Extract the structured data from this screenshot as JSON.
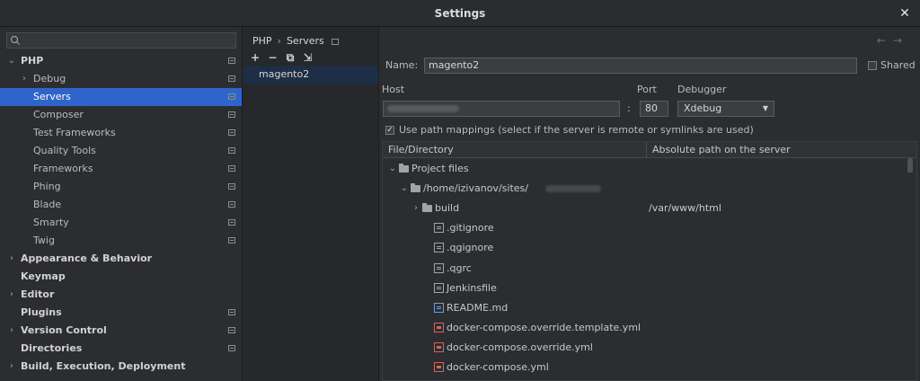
{
  "window": {
    "title": "Settings",
    "close_label": "✕"
  },
  "search": {
    "placeholder": ""
  },
  "tree": [
    {
      "label": "PHP",
      "level": 0,
      "arrow": "⌄",
      "bold": true,
      "project": true
    },
    {
      "label": "Debug",
      "level": 1,
      "arrow": "›",
      "project": true
    },
    {
      "label": "Servers",
      "level": 1,
      "selected": true,
      "project": true
    },
    {
      "label": "Composer",
      "level": 1,
      "project": true
    },
    {
      "label": "Test Frameworks",
      "level": 1,
      "project": true
    },
    {
      "label": "Quality Tools",
      "level": 1,
      "project": true
    },
    {
      "label": "Frameworks",
      "level": 1,
      "project": true
    },
    {
      "label": "Phing",
      "level": 1,
      "project": true
    },
    {
      "label": "Blade",
      "level": 1,
      "project": true
    },
    {
      "label": "Smarty",
      "level": 1,
      "project": true
    },
    {
      "label": "Twig",
      "level": 1,
      "project": true
    },
    {
      "label": "Appearance & Behavior",
      "level": 0,
      "arrow": "›",
      "bold": true
    },
    {
      "label": "Keymap",
      "level": 0,
      "bold": true
    },
    {
      "label": "Editor",
      "level": 0,
      "arrow": "›",
      "bold": true
    },
    {
      "label": "Plugins",
      "level": 0,
      "bold": true,
      "project": true
    },
    {
      "label": "Version Control",
      "level": 0,
      "arrow": "›",
      "bold": true,
      "project": true
    },
    {
      "label": "Directories",
      "level": 0,
      "bold": true,
      "project": true
    },
    {
      "label": "Build, Execution, Deployment",
      "level": 0,
      "arrow": "›",
      "bold": true
    }
  ],
  "breadcrumb": {
    "root": "PHP",
    "sep": "›",
    "current": "Servers"
  },
  "servers_toolbar": {
    "add": "+",
    "remove": "−",
    "copy": "⧉",
    "import": "⇲"
  },
  "servers": [
    "magento2"
  ],
  "nav": {
    "back": "←",
    "forward": "→"
  },
  "form": {
    "name_label": "Name:",
    "name_value": "magento2",
    "shared_label": "Shared",
    "host_label": "Host",
    "port_label": "Port",
    "debugger_label": "Debugger",
    "port_sep": ":",
    "port_value": "80",
    "debugger_value": "Xdebug",
    "path_mappings_label": "Use path mappings (select if the server is remote or symlinks are used)",
    "path_mappings_checked": true
  },
  "mappings": {
    "columns": [
      "File/Directory",
      "Absolute path on the server"
    ],
    "rows": [
      {
        "name": "Project files",
        "indent": 0,
        "arrow": "⌄",
        "icon": "folder"
      },
      {
        "name": "/home/izivanov/sites/",
        "indent": 1,
        "arrow": "⌄",
        "icon": "folder",
        "blurred_suffix": true
      },
      {
        "name": "build",
        "indent": 2,
        "arrow": "›",
        "icon": "folder",
        "abs": "/var/www/html"
      },
      {
        "name": ".gitignore",
        "indent": 3,
        "icon": "file"
      },
      {
        "name": ".qgignore",
        "indent": 3,
        "icon": "file"
      },
      {
        "name": ".qgrc",
        "indent": 3,
        "icon": "file"
      },
      {
        "name": "Jenkinsfile",
        "indent": 3,
        "icon": "file"
      },
      {
        "name": "README.md",
        "indent": 3,
        "icon": "file-md"
      },
      {
        "name": "docker-compose.override.template.yml",
        "indent": 3,
        "icon": "yml"
      },
      {
        "name": "docker-compose.override.yml",
        "indent": 3,
        "icon": "yml"
      },
      {
        "name": "docker-compose.yml",
        "indent": 3,
        "icon": "yml"
      }
    ]
  },
  "icons": {
    "search": "search-icon",
    "project_level": "project-icon",
    "folder": "folder-icon",
    "file": "file-icon",
    "yml": "yaml-file-icon",
    "md": "markdown-file-icon"
  },
  "colors": {
    "selection": "#2f65ca",
    "server_row": "#1d2e46",
    "background": "#2b2d31"
  }
}
